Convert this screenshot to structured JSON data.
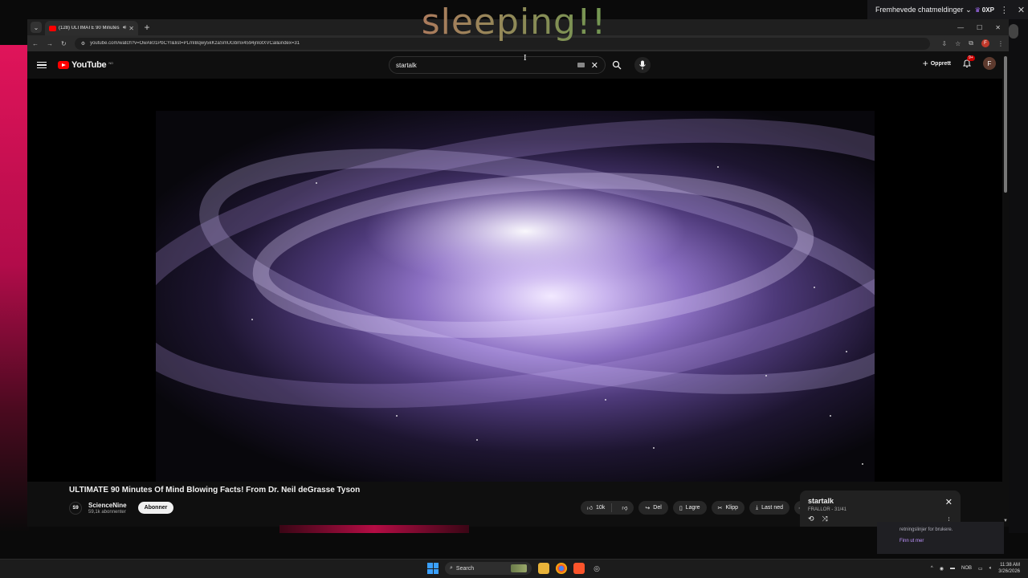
{
  "overlay": {
    "text": "sleeping!!"
  },
  "chat": {
    "header_title": "Fremhevede chatmeldinger",
    "points_value": "0XP",
    "info_text": "retningslinjer for brukere.",
    "info_link": "Finn ut mer"
  },
  "browser": {
    "tab_title": "(128) ULTIMATE 90 Minutes Of Mind Blo...",
    "url": "youtube.com/watch?v=OwAk01PbCYI&list=PLmIBqwy5kKzaSmUGbmx4594jnlotXVCal&index=31"
  },
  "youtube": {
    "logo_text": "YouTube",
    "logo_region": "NO",
    "search_query": "startalk",
    "create_label": "Opprett",
    "notif_badge": "9+",
    "avatar_letter": "F"
  },
  "video": {
    "title": "ULTIMATE 90 Minutes Of Mind Blowing Facts! From Dr. Neil deGrasse Tyson",
    "channel_initials": "S9",
    "channel_name": "ScienceNine",
    "subscribers": "59,1k abonnenter",
    "subscribe_label": "Abonner",
    "like_count": "10k",
    "share_label": "Del",
    "save_label": "Lagre",
    "clip_label": "Klipp",
    "download_label": "Last ned"
  },
  "playlist": {
    "title": "startalk",
    "subtitle": "FRALLOR - 31/41"
  },
  "taskbar": {
    "search_label": "Search",
    "lang": "NOB",
    "time": "11:38 AM",
    "date": "3/26/2026"
  }
}
